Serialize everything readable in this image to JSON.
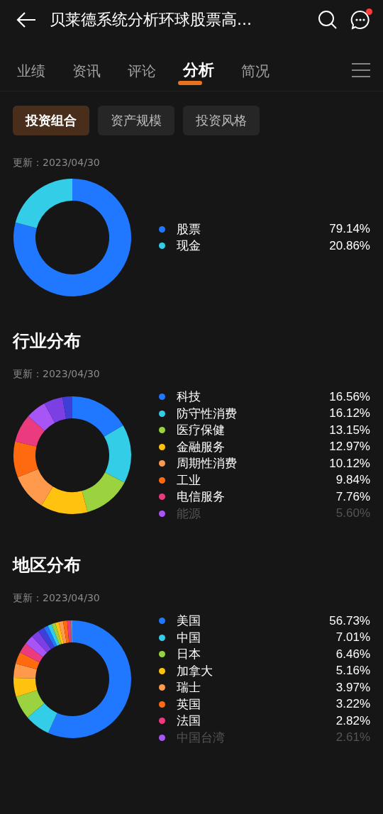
{
  "header": {
    "title": "贝莱德系统分析环球股票高...",
    "has_notification": true
  },
  "tabs": [
    {
      "label": "业绩",
      "selected": false
    },
    {
      "label": "资讯",
      "selected": false
    },
    {
      "label": "评论",
      "selected": false
    },
    {
      "label": "分析",
      "selected": true
    },
    {
      "label": "简况",
      "selected": false
    }
  ],
  "chips": [
    {
      "label": "投资组合",
      "selected": true
    },
    {
      "label": "资产规模",
      "selected": false
    },
    {
      "label": "投资风格",
      "selected": false
    }
  ],
  "sections": [
    {
      "updated": "更新：2023/04/30",
      "legend": [
        {
          "value": "79.14%",
          "color": "#1f78ff"
        },
        {
          "value": "20.86%",
          "color": "#33cde8"
        }
      ],
      "chart_data": {
        "type": "donut",
        "categories": [
          "股票",
          "现金"
        ],
        "values": [
          79.14,
          20.86
        ]
      }
    },
    {
      "heading": "行业分布",
      "updated": "更新：2023/04/30",
      "legend": [
        {
          "value": "16.56%",
          "color": "#1f78ff"
        },
        {
          "value": "16.12%",
          "color": "#33cde8"
        },
        {
          "value": "13.15%",
          "color": "#9ad33f"
        },
        {
          "value": "12.97%",
          "color": "#ffc20e"
        },
        {
          "value": "10.12%",
          "color": "#ff9a4d"
        },
        {
          "value": "9.84%",
          "color": "#ff6a10"
        },
        {
          "value": "7.76%",
          "color": "#ec3a7f"
        },
        {
          "value": "5.60%",
          "color": "#a855f7"
        }
      ],
      "chart_data": {
        "type": "donut",
        "categories": [
          "科技",
          "防守性消费",
          "医疗保健",
          "金融服务",
          "周期性消费",
          "工业",
          "电信服务",
          "能源",
          null,
          null
        ],
        "values": [
          16.56,
          16.12,
          13.15,
          12.97,
          10.12,
          9.84,
          7.76,
          5.6,
          5.2,
          2.68
        ]
      }
    },
    {
      "heading": "地区分布",
      "updated": "更新：2023/04/30",
      "legend": [
        {
          "value": "56.73%",
          "color": "#1f78ff"
        },
        {
          "value": "7.01%",
          "color": "#33cde8"
        },
        {
          "value": "6.46%",
          "color": "#9ad33f"
        },
        {
          "value": "5.16%",
          "color": "#ffc20e"
        },
        {
          "value": "3.97%",
          "color": "#ff9a4d"
        },
        {
          "value": "3.22%",
          "color": "#ff6a10"
        },
        {
          "value": "2.82%",
          "color": "#ec3a7f"
        },
        {
          "value": "2.61%",
          "color": "#a855f7"
        }
      ],
      "chart_data": {
        "type": "donut",
        "categories": [
          "美国",
          "中国",
          "日本",
          "加拿大",
          "瑞士",
          "英国",
          "法国",
          "中国台湾",
          null,
          null,
          null,
          null,
          null,
          null,
          null,
          null,
          null,
          null
        ],
        "values": [
          56.73,
          7.01,
          6.46,
          5.16,
          3.97,
          3.22,
          2.82,
          2.61,
          2.2,
          1.8,
          1.2,
          1.1,
          1.0,
          1.0,
          1.2,
          1.1,
          1.0,
          0.42
        ]
      }
    }
  ]
}
